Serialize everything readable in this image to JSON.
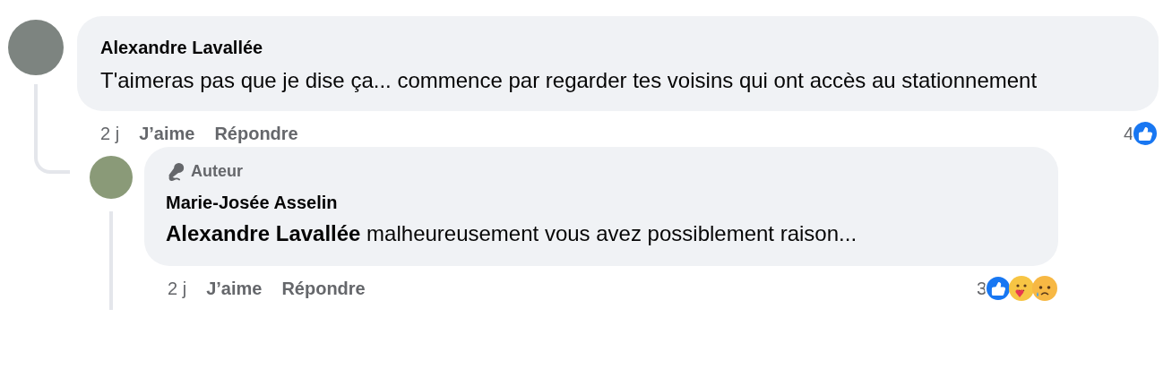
{
  "comments": [
    {
      "author": "Alexandre Lavallée",
      "text": "T'aimeras pas que je dise ça... commence par regarder tes voisins qui ont accès au stationnement",
      "time": "2 j",
      "like": "J’aime",
      "reply": "Répondre",
      "reaction_count": "4",
      "reactions": [
        {
          "kind": "like"
        }
      ],
      "children": [
        {
          "author": "Marie-Josée Asselin",
          "badge": "Auteur",
          "text": "**Alexandre Lavallée** malheureusement vous avez possiblement raison...",
          "time": "2 j",
          "like": "J’aime",
          "reply": "Répondre",
          "reaction_count": "3",
          "reactions": [
            {
              "kind": "like"
            },
            {
              "kind": "care"
            },
            {
              "kind": "sad"
            }
          ]
        }
      ]
    }
  ]
}
